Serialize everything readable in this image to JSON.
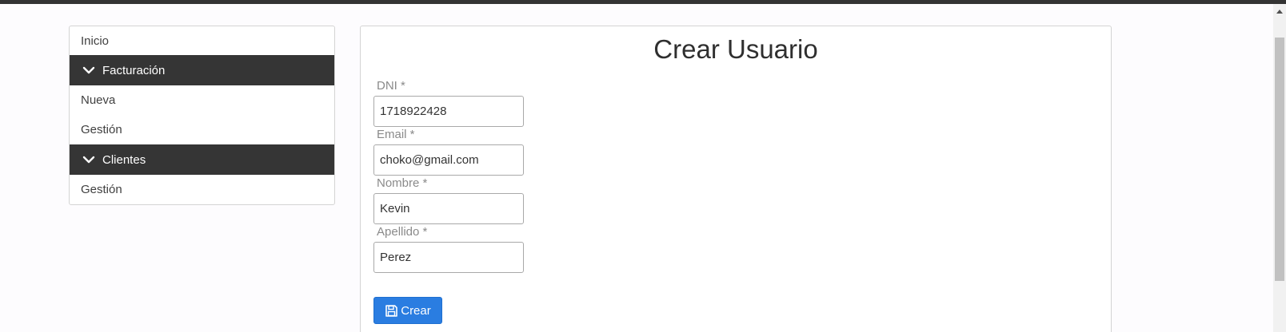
{
  "sidebar": {
    "inicio": "Inicio",
    "groups": [
      {
        "label": "Facturación",
        "items": [
          "Nueva",
          "Gestión"
        ]
      },
      {
        "label": "Clientes",
        "items": [
          "Gestión"
        ]
      }
    ]
  },
  "form": {
    "title": "Crear Usuario",
    "fields": [
      {
        "label": "DNI *",
        "value": "1718922428"
      },
      {
        "label": "Email *",
        "value": "choko@gmail.com"
      },
      {
        "label": "Nombre *",
        "value": "Kevin"
      },
      {
        "label": "Apellido *",
        "value": "Perez"
      }
    ],
    "submit_label": "Crear"
  },
  "icons": {
    "chevron": "chevron-down-icon",
    "save": "floppy-disk-icon"
  },
  "colors": {
    "sidebar_group_bg": "#353535",
    "button_primary": "#2a7de1",
    "top_strip": "#343434"
  }
}
